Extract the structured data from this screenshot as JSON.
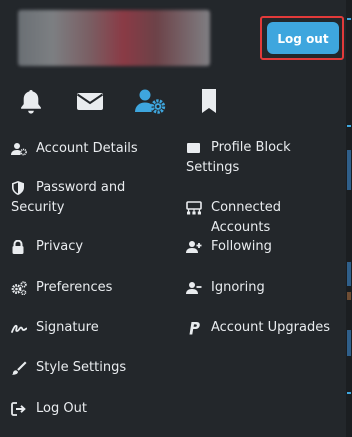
{
  "header": {
    "logout_button": "Log out"
  },
  "tabs": [
    {
      "icon": "bell-icon"
    },
    {
      "icon": "envelope-icon"
    },
    {
      "icon": "user-settings-icon",
      "active": true
    },
    {
      "icon": "bookmark-icon"
    }
  ],
  "menu": {
    "left": [
      {
        "label": "Account Details",
        "icon": "user-cog-icon"
      },
      {
        "label": "Password and Security",
        "icon": "shield-icon"
      },
      {
        "label": "Privacy",
        "icon": "lock-icon"
      },
      {
        "label": "Preferences",
        "icon": "cogs-icon"
      },
      {
        "label": "Signature",
        "icon": "signature-icon"
      },
      {
        "label": "Style Settings",
        "icon": "brush-icon"
      },
      {
        "label": "Log Out",
        "icon": "sign-out-icon"
      }
    ],
    "right": [
      {
        "label": "Profile Block Settings",
        "icon": "square-icon"
      },
      {
        "label": "Connected Accounts",
        "icon": "network-icon"
      },
      {
        "label": "Following",
        "icon": "user-plus-icon"
      },
      {
        "label": "Ignoring",
        "icon": "user-minus-icon"
      },
      {
        "label": "Account Upgrades",
        "icon": "paypal-icon"
      }
    ]
  },
  "colors": {
    "accent": "#3ea6de",
    "highlight": "#e23a3a",
    "background": "#23272b",
    "text": "#e9ecef"
  }
}
